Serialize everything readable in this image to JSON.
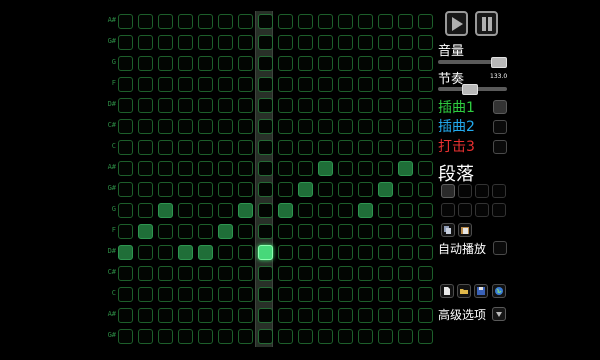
{
  "note_labels": [
    "A#",
    "G#",
    "G",
    "F",
    "D#",
    "C#",
    "C",
    "A#",
    "G#",
    "G",
    "F",
    "D#",
    "C#",
    "C",
    "A#",
    "G#"
  ],
  "grid": {
    "columns": 16,
    "rows": 16,
    "playhead_column": 7,
    "active_cells": [
      {
        "row": 7,
        "col": 10
      },
      {
        "row": 7,
        "col": 14
      },
      {
        "row": 8,
        "col": 9
      },
      {
        "row": 8,
        "col": 13
      },
      {
        "row": 9,
        "col": 2
      },
      {
        "row": 9,
        "col": 6
      },
      {
        "row": 9,
        "col": 8
      },
      {
        "row": 9,
        "col": 12
      },
      {
        "row": 10,
        "col": 1
      },
      {
        "row": 10,
        "col": 5
      },
      {
        "row": 11,
        "col": 0
      },
      {
        "row": 11,
        "col": 3
      },
      {
        "row": 11,
        "col": 4
      }
    ],
    "highlighted_cells": [
      {
        "row": 11,
        "col": 7
      }
    ]
  },
  "transport": {
    "play_icon": "play-icon",
    "pause_icon": "pause-icon"
  },
  "volume": {
    "label": "音量",
    "level": 1.0
  },
  "tempo": {
    "label": "节奏",
    "value": "133.0",
    "level": 0.45
  },
  "tracks": [
    {
      "label": "插曲1",
      "color": "#2ecc40",
      "checked": true
    },
    {
      "label": "插曲2",
      "color": "#22aaee",
      "checked": false
    },
    {
      "label": "打击3",
      "color": "#e83030",
      "checked": false
    }
  ],
  "section": {
    "title": "段落",
    "slots": 8,
    "active_slot": 0
  },
  "clipboard": {
    "copy_icon": "copy-icon",
    "paste_icon": "paste-icon"
  },
  "autoplay": {
    "label": "自动播放",
    "checked": false
  },
  "file_icons": [
    "new-file-icon",
    "open-folder-icon",
    "save-icon",
    "globe-icon"
  ],
  "advanced": {
    "label": "高级选项",
    "icon": "chevron-down-icon"
  }
}
